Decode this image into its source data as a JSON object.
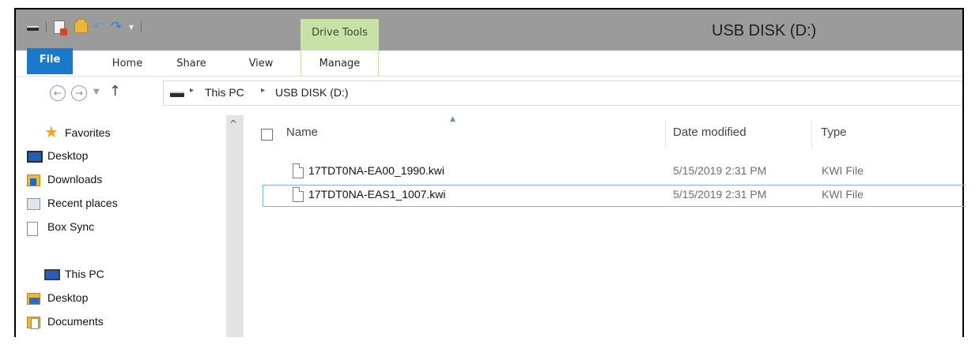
{
  "window": {
    "title": "USB DISK (D:)",
    "contextual_tab_group": "Drive Tools"
  },
  "quick_access_toolbar": {
    "icons": [
      "drive-icon",
      "properties-icon",
      "new-folder-icon",
      "undo-icon",
      "redo-icon",
      "customize-dropdown-icon"
    ]
  },
  "ribbon": {
    "tabs": [
      {
        "label": "File",
        "active": false
      },
      {
        "label": "Home",
        "active": false
      },
      {
        "label": "Share",
        "active": false
      },
      {
        "label": "View",
        "active": false
      },
      {
        "label": "Manage",
        "active": false
      }
    ]
  },
  "address_bar": {
    "breadcrumbs": [
      "This PC",
      "USB DISK (D:)"
    ],
    "separator": "▸"
  },
  "navigation": {
    "favorites": {
      "label": "Favorites",
      "items": [
        {
          "label": "Desktop",
          "icon": "desktop-icon"
        },
        {
          "label": "Downloads",
          "icon": "downloads-icon"
        },
        {
          "label": "Recent places",
          "icon": "recent-places-icon"
        },
        {
          "label": "Box Sync",
          "icon": "box-sync-icon"
        }
      ]
    },
    "this_pc": {
      "label": "This PC",
      "items": [
        {
          "label": "Desktop",
          "icon": "desktop-folder-icon"
        },
        {
          "label": "Documents",
          "icon": "documents-icon"
        }
      ]
    }
  },
  "file_list": {
    "columns": [
      "Name",
      "Date modified",
      "Type"
    ],
    "sorted_by": "Name",
    "rows": [
      {
        "name": "17TDT0NA-EA00_1990.kwi",
        "date_modified": "5/15/2019 2:31 PM",
        "type": "KWI File",
        "focused": false
      },
      {
        "name": "17TDT0NA-EAS1_1007.kwi",
        "date_modified": "5/15/2019 2:31 PM",
        "type": "KWI File",
        "focused": true
      }
    ]
  },
  "colors": {
    "title_bar": "#9b9b9b",
    "file_tab": "#1979ca",
    "contextual_tab": "#c7e1a7",
    "focus_border": "#7cb4e6",
    "scrollbar": "#e3e3e3"
  }
}
